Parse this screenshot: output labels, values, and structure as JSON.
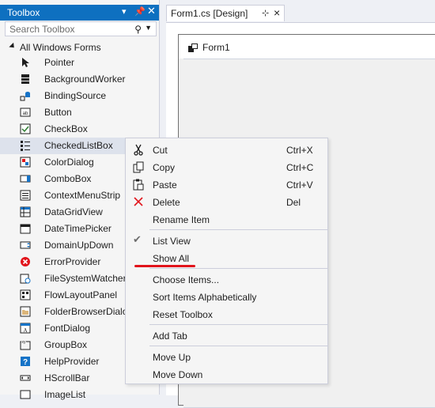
{
  "toolbox": {
    "title": "Toolbox",
    "search_placeholder": "Search Toolbox",
    "category": "All Windows Forms",
    "items": [
      {
        "label": "Pointer",
        "icon": "pointer-icon"
      },
      {
        "label": "BackgroundWorker",
        "icon": "backgroundworker-icon"
      },
      {
        "label": "BindingSource",
        "icon": "bindingsource-icon"
      },
      {
        "label": "Button",
        "icon": "button-icon"
      },
      {
        "label": "CheckBox",
        "icon": "checkbox-icon"
      },
      {
        "label": "CheckedListBox",
        "icon": "checkedlistbox-icon",
        "selected": true
      },
      {
        "label": "ColorDialog",
        "icon": "colordialog-icon"
      },
      {
        "label": "ComboBox",
        "icon": "combobox-icon"
      },
      {
        "label": "ContextMenuStrip",
        "icon": "contextmenustrip-icon"
      },
      {
        "label": "DataGridView",
        "icon": "datagridview-icon"
      },
      {
        "label": "DateTimePicker",
        "icon": "datetimepicker-icon"
      },
      {
        "label": "DomainUpDown",
        "icon": "domainupdown-icon"
      },
      {
        "label": "ErrorProvider",
        "icon": "errorprovider-icon"
      },
      {
        "label": "FileSystemWatcher",
        "icon": "filesystemwatcher-icon"
      },
      {
        "label": "FlowLayoutPanel",
        "icon": "flowlayoutpanel-icon"
      },
      {
        "label": "FolderBrowserDialo",
        "icon": "folderbrowserdialog-icon"
      },
      {
        "label": "FontDialog",
        "icon": "fontdialog-icon"
      },
      {
        "label": "GroupBox",
        "icon": "groupbox-icon"
      },
      {
        "label": "HelpProvider",
        "icon": "helpprovider-icon"
      },
      {
        "label": "HScrollBar",
        "icon": "hscrollbar-icon"
      },
      {
        "label": "ImageList",
        "icon": "imagelist-icon"
      }
    ]
  },
  "designer": {
    "tab_label": "Form1.cs [Design]",
    "form_title": "Form1"
  },
  "context_menu": {
    "items": [
      {
        "label": "Cut",
        "shortcut": "Ctrl+X",
        "icon": "cut-icon"
      },
      {
        "label": "Copy",
        "shortcut": "Ctrl+C",
        "icon": "copy-icon"
      },
      {
        "label": "Paste",
        "shortcut": "Ctrl+V",
        "icon": "paste-icon"
      },
      {
        "label": "Delete",
        "shortcut": "Del",
        "icon": "delete-icon"
      },
      {
        "label": "Rename Item",
        "shortcut": ""
      },
      {
        "label": "List View",
        "shortcut": "",
        "checked": true,
        "icon": "checkmark-icon"
      },
      {
        "label": "Show All",
        "shortcut": "",
        "highlighted": true
      },
      {
        "label": "Choose Items...",
        "shortcut": ""
      },
      {
        "label": "Sort Items Alphabetically",
        "shortcut": ""
      },
      {
        "label": "Reset Toolbox",
        "shortcut": ""
      },
      {
        "label": "Add Tab",
        "shortcut": ""
      },
      {
        "label": "Move Up",
        "shortcut": ""
      },
      {
        "label": "Move Down",
        "shortcut": ""
      }
    ]
  },
  "colors": {
    "accent": "#0e70c0",
    "highlight_underline": "#e1141b",
    "selected_item": "#dde2ec"
  }
}
